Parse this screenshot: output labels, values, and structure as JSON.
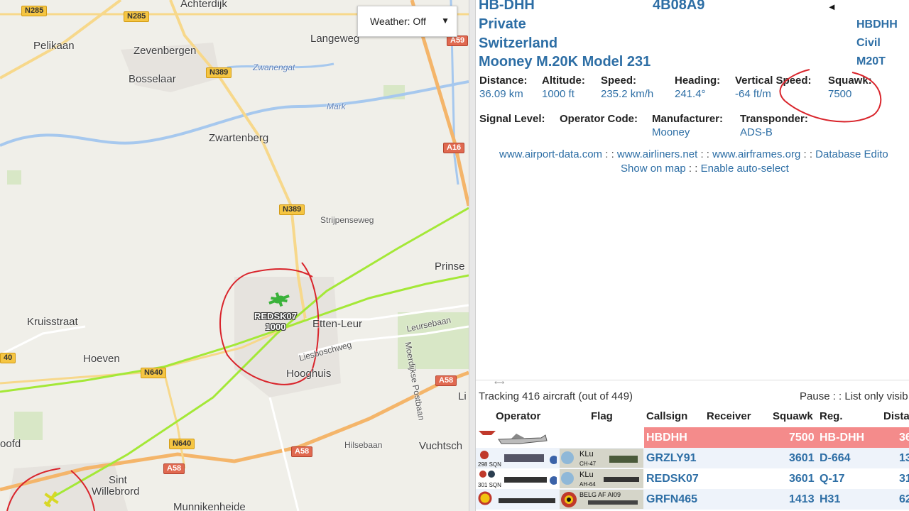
{
  "map": {
    "weather_label": "Weather: Off",
    "places": [
      {
        "name": "Achterdijk",
        "cls": "place"
      },
      {
        "name": "Pelikaan",
        "cls": "place"
      },
      {
        "name": "Zevenbergen",
        "cls": "place"
      },
      {
        "name": "Langeweg",
        "cls": "place"
      },
      {
        "name": "Bosselaar",
        "cls": "place"
      },
      {
        "name": "Zwanengat",
        "cls": "place water"
      },
      {
        "name": "Mark",
        "cls": "place water"
      },
      {
        "name": "Zwartenberg",
        "cls": "place"
      },
      {
        "name": "Strijpenseweg",
        "cls": "place small"
      },
      {
        "name": "Prinse",
        "cls": "place"
      },
      {
        "name": "Kruisstraat",
        "cls": "place"
      },
      {
        "name": "Etten-Leur",
        "cls": "place"
      },
      {
        "name": "Hoeven",
        "cls": "place"
      },
      {
        "name": "Leursebaan",
        "cls": "place small"
      },
      {
        "name": "Liesboschweg",
        "cls": "place small"
      },
      {
        "name": "Hooghuis",
        "cls": "place"
      },
      {
        "name": "Moerdijkse Postbaan",
        "cls": "place small"
      },
      {
        "name": "Hilsebaan",
        "cls": "place small"
      },
      {
        "name": "Vuchtsch",
        "cls": "place"
      },
      {
        "name": "oofd",
        "cls": "place"
      },
      {
        "name": "Sint",
        "cls": "place"
      },
      {
        "name": "Willebrord",
        "cls": "place"
      },
      {
        "name": "Munnikenheide",
        "cls": "place"
      },
      {
        "name": "Li",
        "cls": "place"
      }
    ],
    "roads": [
      "N285",
      "N285",
      "A59",
      "N389",
      "A16",
      "N389",
      "N640",
      "A58",
      "N640",
      "A58",
      "A58",
      "40"
    ],
    "aircraft_callsign": "REDSK07",
    "aircraft_alt": "1000"
  },
  "info": {
    "registration": "HB-DHH",
    "icao": "4B08A9",
    "owner": "Private",
    "country": "Switzerland",
    "model": "Mooney M.20K Model 231",
    "callsign_right": "HBDHH",
    "category": "Civil",
    "type_code": "M20T",
    "fields_row1": [
      {
        "label": "Distance:",
        "value": "36.09 km"
      },
      {
        "label": "Altitude:",
        "value": "1000 ft"
      },
      {
        "label": "Speed:",
        "value": "235.2 km/h"
      },
      {
        "label": "Heading:",
        "value": "241.4°"
      },
      {
        "label": "Vertical Speed:",
        "value": "-64 ft/m"
      },
      {
        "label": "Squawk:",
        "value": "7500"
      }
    ],
    "fields_row2": [
      {
        "label": "Signal Level:",
        "value": ""
      },
      {
        "label": "Operator Code:",
        "value": ""
      },
      {
        "label": "Manufacturer:",
        "value": "Mooney"
      },
      {
        "label": "Transponder:",
        "value": "ADS-B"
      }
    ],
    "links1": [
      "www.airport-data.com",
      "www.airliners.net",
      "www.airframes.org",
      "Database Edito"
    ],
    "links2": [
      "Show on map",
      "Enable auto-select"
    ],
    "link_sep": " : : "
  },
  "list": {
    "tracking": "Tracking 416 aircraft (out of 449)",
    "pause": "Pause : : List only visib",
    "headers": [
      "Operator",
      "Flag",
      "Callsign",
      "Receiver",
      "Squawk",
      "Reg.",
      "Dista"
    ],
    "rows": [
      {
        "callsign": "HBDHH",
        "squawk": "7500",
        "reg": "HB-DHH",
        "dist": "36",
        "selected": true
      },
      {
        "callsign": "GRZLY91",
        "squawk": "3601",
        "reg": "D-664",
        "dist": "13",
        "selected": false
      },
      {
        "callsign": "REDSK07",
        "squawk": "3601",
        "reg": "Q-17",
        "dist": "31",
        "selected": false
      },
      {
        "callsign": "GRFN465",
        "squawk": "1413",
        "reg": "H31",
        "dist": "62",
        "selected": false
      }
    ],
    "op_texts": [
      "298 SQN",
      "301 SQN"
    ],
    "flag_texts": [
      "KLu",
      "CH-47",
      "KLu",
      "AH-64",
      "BELG AF AI09"
    ]
  },
  "colors": {
    "accent": "#2d6ea5",
    "selected_row": "#f48b8b",
    "track_line": "#a4e837",
    "annotation": "#d9252c"
  }
}
